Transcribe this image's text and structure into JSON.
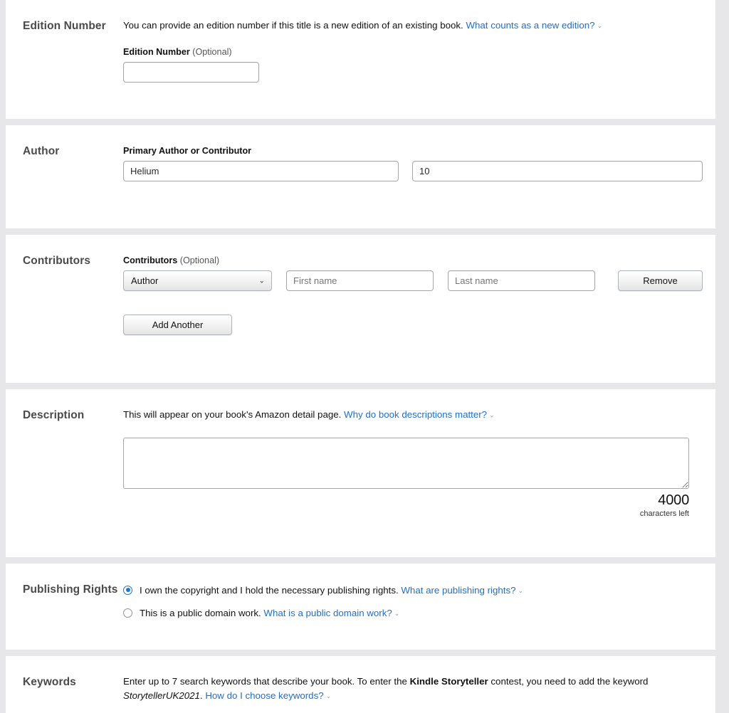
{
  "sections": {
    "edition": {
      "heading": "Edition Number",
      "helper_text": "You can provide an edition number if this title is a new edition of an existing book.",
      "help_link": "What counts as a new edition?",
      "field_label": "Edition Number",
      "field_optional": "(Optional)",
      "input_value": "",
      "input_placeholder": ""
    },
    "author": {
      "heading": "Author",
      "field_label": "Primary Author or Contributor",
      "first_value": "Helium",
      "first_placeholder": "",
      "second_value": "10",
      "second_placeholder": ""
    },
    "contributors": {
      "heading": "Contributors",
      "field_label": "Contributors",
      "field_optional": "(Optional)",
      "role_selected": "Author",
      "role_options": [
        "Author"
      ],
      "first_name_value": "",
      "first_name_placeholder": "First name",
      "last_name_value": "",
      "last_name_placeholder": "Last name",
      "remove_label": "Remove",
      "add_another_label": "Add Another"
    },
    "description": {
      "heading": "Description",
      "helper_text": "This will appear on your book's Amazon detail page.",
      "help_link": "Why do book descriptions matter?",
      "textarea_value": "",
      "textarea_placeholder": "",
      "counter_number": "4000",
      "counter_label": "characters left"
    },
    "publishing_rights": {
      "heading": "Publishing Rights",
      "option_own": {
        "label": "I own the copyright and I hold the necessary publishing rights.",
        "help_link": "What are publishing rights?",
        "selected": true
      },
      "option_public_domain": {
        "label": "This is a public domain work.",
        "help_link": "What is a public domain work?",
        "selected": false
      }
    },
    "keywords": {
      "heading": "Keywords",
      "helper_text_part1": "Enter up to 7 search keywords that describe your book. To enter the ",
      "helper_bold": "Kindle Storyteller",
      "helper_text_part2": " contest, you need to add the keyword ",
      "helper_italic": "StorytellerUK2021",
      "helper_text_part3": ". ",
      "help_link": "How do I choose keywords?"
    }
  },
  "icons": {
    "chevron_down": "⌄"
  },
  "colors": {
    "link": "#1f6fc4",
    "radio_selected": "#2176d2",
    "panel_background": "#ffffff",
    "page_background": "#e7e7e9",
    "heading_text": "#4a4a4a"
  }
}
